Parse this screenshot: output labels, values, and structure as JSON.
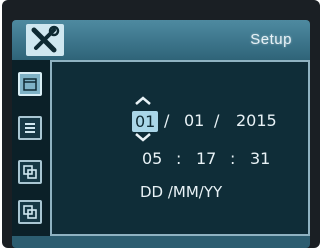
{
  "header": {
    "title": "Setup",
    "icon": "tools-icon"
  },
  "sidebar": {
    "items": [
      {
        "icon": "calendar-icon",
        "active": true
      },
      {
        "icon": "list-icon",
        "active": false
      },
      {
        "icon": "copy-icon",
        "active": false
      },
      {
        "icon": "copy-icon",
        "active": false
      }
    ]
  },
  "date": {
    "day": "01",
    "sep1": "/",
    "month": "01",
    "sep2": "/",
    "year": "2015"
  },
  "time": {
    "hour": "05",
    "sep1": ":",
    "minute": "17",
    "sep2": ":",
    "second": "31"
  },
  "format": {
    "label": "DD /MM/YY"
  },
  "colors": {
    "title_bar": "#3b7389",
    "screen_bg": "#0e2a33",
    "selected_field": "#a9d6e8"
  }
}
